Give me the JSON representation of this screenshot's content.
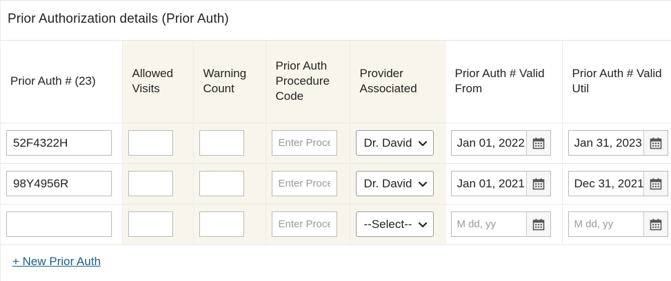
{
  "panel": {
    "title": "Prior Authorization details (Prior Auth)"
  },
  "table": {
    "headers": [
      "Prior Auth # (23)",
      "Allowed Visits",
      "Warning Count",
      "Prior Auth Procedure Code",
      "Provider Associated",
      "Prior Auth # Valid From",
      "Prior Auth # Valid Util"
    ],
    "rows": [
      {
        "prior_auth_number": "52F4322H",
        "allowed_visits": "",
        "warning_count": "",
        "procedure_code": "",
        "provider": "Dr. David",
        "valid_from": "Jan 01, 2022",
        "valid_until": "Jan 31, 2023"
      },
      {
        "prior_auth_number": "98Y4956R",
        "allowed_visits": "",
        "warning_count": "",
        "procedure_code": "",
        "provider": "Dr. David",
        "valid_from": "Jan 01, 2021",
        "valid_until": "Dec 31, 2021"
      },
      {
        "prior_auth_number": "",
        "allowed_visits": "",
        "warning_count": "",
        "procedure_code": "",
        "provider": "--Select--",
        "valid_from": "",
        "valid_until": ""
      }
    ],
    "placeholders": {
      "procedure_code": "Enter Procedure Code",
      "date": "M dd, yy"
    }
  },
  "actions": {
    "new_prior_auth": "+ New Prior Auth"
  },
  "icons": {
    "calendar": "calendar-icon",
    "dropdown": "chevron-down-icon"
  },
  "colors": {
    "shaded_column": "#f8f6ec",
    "link": "#1a5f86"
  }
}
